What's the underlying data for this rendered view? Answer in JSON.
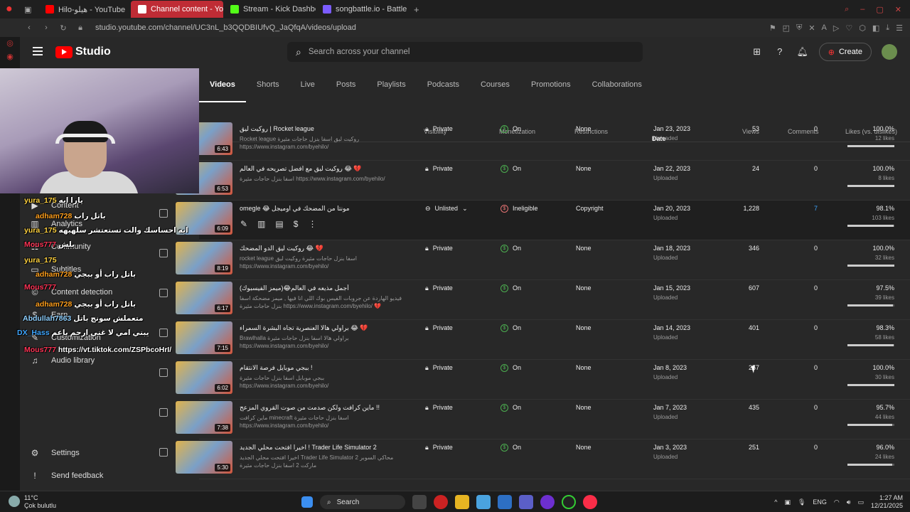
{
  "browser": {
    "tabs": [
      {
        "label": "Hilo-هيلو - YouTube",
        "color": "#ff0000"
      },
      {
        "label": "Channel content - YouTu",
        "color": "#ffffff"
      },
      {
        "label": "Stream - Kick Dashboard",
        "color": "#53fc18"
      },
      {
        "label": "songbattle.io - Battle Song",
        "color": "#7b5cff"
      }
    ],
    "url": "studio.youtube.com/channel/UC3nL_b3QQDBIUfvQ_JaQfqA/videos/upload"
  },
  "header": {
    "logo_text": "Studio",
    "search_placeholder": "Search across your channel",
    "create_label": "Create"
  },
  "sidebar": {
    "items": [
      {
        "label": "Content",
        "icon": "content-icon"
      },
      {
        "label": "Analytics",
        "icon": "analytics-icon"
      },
      {
        "label": "Community",
        "icon": "community-icon"
      },
      {
        "label": "Subtitles",
        "icon": "subtitles-icon"
      },
      {
        "label": "Content detection",
        "icon": "copyright-icon"
      },
      {
        "label": "Earn",
        "icon": "earn-icon"
      },
      {
        "label": "Customization",
        "icon": "customization-icon"
      },
      {
        "label": "Audio library",
        "icon": "audio-library-icon"
      }
    ],
    "settings": "Settings",
    "feedback": "Send feedback"
  },
  "tabs": [
    "Videos",
    "Shorts",
    "Live",
    "Posts",
    "Playlists",
    "Podcasts",
    "Courses",
    "Promotions",
    "Collaborations"
  ],
  "columns": {
    "visibility": "Visibility",
    "monetization": "Monetization",
    "restrictions": "Restrictions",
    "date": "Date",
    "views": "Views",
    "comments": "Comments",
    "likes": "Likes (vs. dislikes)"
  },
  "rows": [
    {
      "title": "روكيت ليق | Rocket league",
      "desc": "Rocket league روكيت ليق اسفا بنزل حاجات مثيرة\nhttps://www.instagram.com/byehilo/",
      "duration": "6:43",
      "visibility": "Private",
      "monetization": "On",
      "restrictions": "None",
      "date": "Jan 23, 2023",
      "status": "Uploaded",
      "views": "53",
      "comments": "0",
      "likes_pct": "100.0%",
      "likes_count": "12 likes",
      "likes_ratio": 1.0
    },
    {
      "title": "روكيت ليق مع افضل تصريحه في العالم 😂 💔",
      "desc": "اسفا بنزل حاجات مثيرة https://www.instagram.com/byehilo/",
      "duration": "6:53",
      "visibility": "Private",
      "monetization": "On",
      "restrictions": "None",
      "date": "Jan 22, 2023",
      "status": "Uploaded",
      "views": "24",
      "comments": "0",
      "likes_pct": "100.0%",
      "likes_count": "8 likes",
      "likes_ratio": 1.0
    },
    {
      "title": "omegle 😂 مونتا من المضحك في اوميجل",
      "desc": "",
      "duration": "6:09",
      "visibility": "Unlisted",
      "monetization": "Ineligible",
      "restrictions": "Copyright",
      "date": "Jan 20, 2023",
      "status": "Uploaded",
      "views": "1,228",
      "comments": "7",
      "likes_pct": "98.1%",
      "likes_count": "103 likes",
      "likes_ratio": 0.981
    },
    {
      "title": "روكيت ليق الدو المضحك 😂 💔",
      "desc": "rocket league اسفا بنزل حاجات مثيرة روكيت ليق\nhttps://www.instagram.com/byehilo/",
      "duration": "8:19",
      "visibility": "Private",
      "monetization": "On",
      "restrictions": "None",
      "date": "Jan 18, 2023",
      "status": "Uploaded",
      "views": "346",
      "comments": "0",
      "likes_pct": "100.0%",
      "likes_count": "32 likes",
      "likes_ratio": 1.0
    },
    {
      "title": "أجمل مذيعه في العالم😂(ميمز الفيسبوك)",
      "desc": "فيديو الهاردة عن جروبات الفيس بوك اللي انا فيها , ميمز مضحكة اسفا بنزل حاجات مثيرة\nhttps://www.instagram.com/byehilo/ 💔",
      "duration": "6:17",
      "visibility": "Private",
      "monetization": "On",
      "restrictions": "None",
      "date": "Jan 15, 2023",
      "status": "Uploaded",
      "views": "607",
      "comments": "0",
      "likes_pct": "97.5%",
      "likes_count": "39 likes",
      "likes_ratio": 0.975
    },
    {
      "title": "براولي هالا العنصرية تجاه البشرة السمراء 😂 💔",
      "desc": "Brawlhalla براولي هالا اسفا بنزل حاجات مثيرة\nhttps://www.instagram.com/byehilo/",
      "duration": "7:15",
      "visibility": "Private",
      "monetization": "On",
      "restrictions": "None",
      "date": "Jan 14, 2023",
      "status": "Uploaded",
      "views": "401",
      "comments": "0",
      "likes_pct": "98.3%",
      "likes_count": "58 likes",
      "likes_ratio": 0.983
    },
    {
      "title": "ببجي موبايل فرصة الانتقام !",
      "desc": "ببجي موبايل اسفا بنزل حاجات مثيرة https://www.instagram.com/byehilo/",
      "duration": "6:02",
      "visibility": "Private",
      "monetization": "On",
      "restrictions": "None",
      "date": "Jan 8, 2023",
      "status": "Uploaded",
      "views": "257",
      "comments": "0",
      "likes_pct": "100.0%",
      "likes_count": "30 likes",
      "likes_ratio": 1.0
    },
    {
      "title": "ماين كرافت ولكن صدمت من صوت القروي المزعج !!",
      "desc": "ماين كرافت minecraft اسفا بنزل حاجات مثيرة\nhttps://www.instagram.com/byehilo/",
      "duration": "7:38",
      "visibility": "Private",
      "monetization": "On",
      "restrictions": "None",
      "date": "Jan 7, 2023",
      "status": "Uploaded",
      "views": "435",
      "comments": "0",
      "likes_pct": "95.7%",
      "likes_count": "44 likes",
      "likes_ratio": 0.957
    },
    {
      "title": "اخيرا افتحت محلي الجديد ! Trader Life Simulator 2",
      "desc": "اخيرا افتحت محلي الجديد Trader Life Simulator 2 محاكي السوبر ماركت 2 اسفا بنزل حاجات مثيرة https://www.instagram.com/byehilo/",
      "duration": "5:30",
      "visibility": "Private",
      "monetization": "On",
      "restrictions": "None",
      "date": "Jan 3, 2023",
      "status": "Uploaded",
      "views": "251",
      "comments": "0",
      "likes_pct": "96.0%",
      "likes_count": "24 likes",
      "likes_ratio": 0.96
    }
  ],
  "chat": [
    {
      "user": "yura_175",
      "text": "يارا ايه",
      "color": "#ffd23f"
    },
    {
      "user": "adham728",
      "text": "باتل راب",
      "color": "#ff9f1c"
    },
    {
      "user": "yura_175",
      "text": "ايه احساسك والت تستعتشر سلهبهه",
      "color": "#ffd23f"
    },
    {
      "user": "Mous777",
      "text": "بلش",
      "color": "#ff3355"
    },
    {
      "user": "yura_175",
      "text": "",
      "color": "#ffd23f"
    },
    {
      "user": "adham728",
      "text": "باتل راب أو ببجي",
      "color": "#ff9f1c"
    },
    {
      "user": "Mous777",
      "text": "",
      "color": "#ff3355"
    },
    {
      "user": "adham728",
      "text": "باتل راب أو ببجي",
      "color": "#ff9f1c"
    },
    {
      "user": "Abdullah7863",
      "text": "متعملش سونج باتل",
      "color": "#8fd0ff"
    },
    {
      "user": "DX_Hass",
      "text": "يبني امي لا غني ارحم ياعم",
      "color": "#3ea6ff"
    },
    {
      "user": "Mous777",
      "text": "https://vt.tiktok.com/ZSPbcoHrI/",
      "color": "#ff3355"
    }
  ],
  "taskbar": {
    "temp": "11°C",
    "weather": "Çok bulutlu",
    "search": "Search",
    "lang": "ENG",
    "time": "1:27 AM",
    "date": "12/21/2025"
  }
}
